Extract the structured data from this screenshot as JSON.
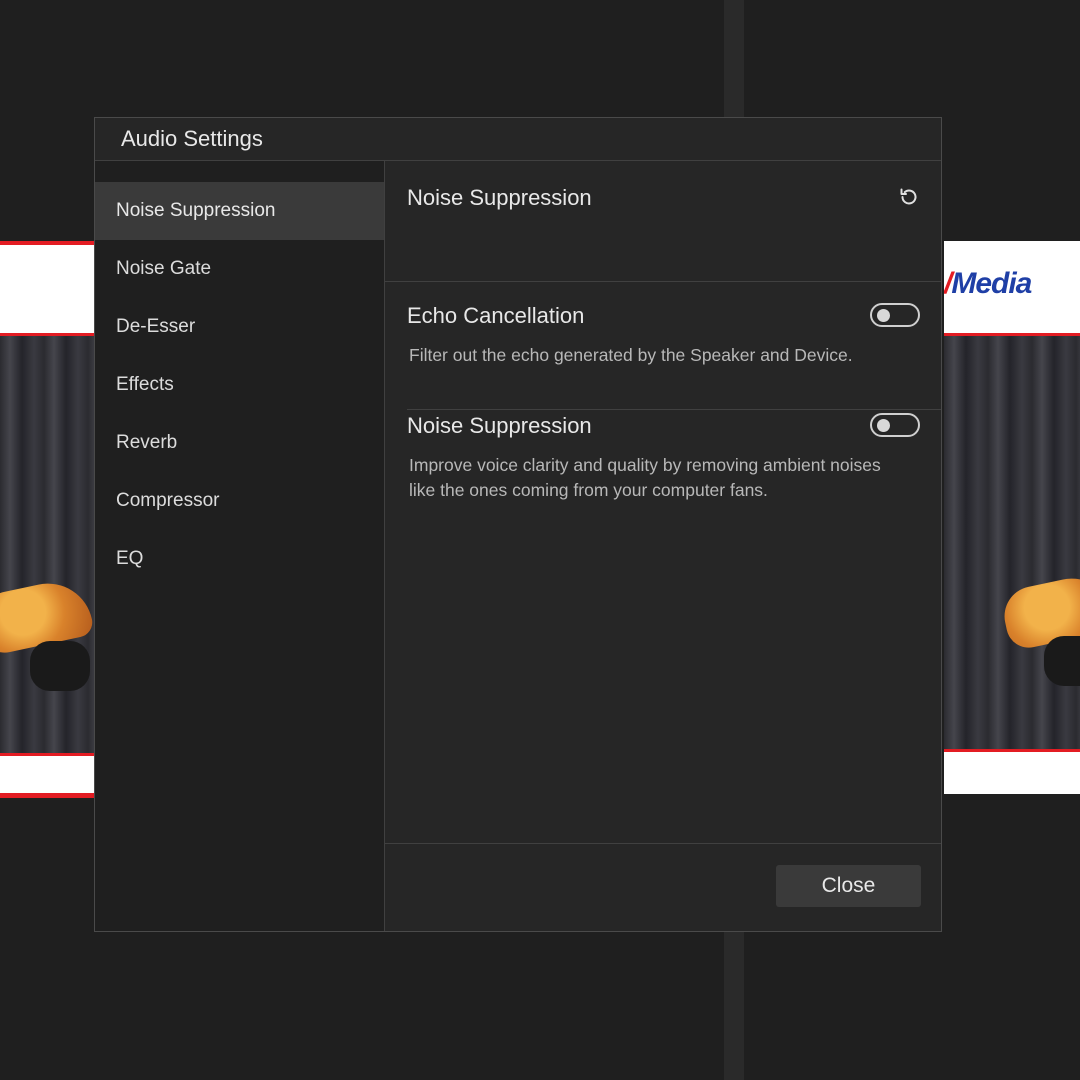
{
  "dialog": {
    "title": "Audio Settings",
    "close_label": "Close"
  },
  "sidebar": {
    "items": [
      {
        "label": "Noise Suppression",
        "active": true
      },
      {
        "label": "Noise Gate",
        "active": false
      },
      {
        "label": "De-Esser",
        "active": false
      },
      {
        "label": "Effects",
        "active": false
      },
      {
        "label": "Reverb",
        "active": false
      },
      {
        "label": "Compressor",
        "active": false
      },
      {
        "label": "EQ",
        "active": false
      }
    ]
  },
  "content": {
    "title": "Noise Suppression",
    "reset_icon": "reset-icon",
    "settings": [
      {
        "title": "Echo Cancellation",
        "description": "Filter out the echo generated by the Speaker and Device.",
        "enabled": false
      },
      {
        "title": "Noise Suppression",
        "description": "Improve voice clarity and quality by removing ambient noises like the ones coming from your computer fans.",
        "enabled": false
      }
    ]
  },
  "background": {
    "brand_text": "Media"
  },
  "colors": {
    "dialog_bg": "#262626",
    "sidebar_bg": "#1f1f1f",
    "active_item_bg": "#3a3a3a",
    "brand_red": "#e31c23",
    "brand_blue": "#1f3fa6"
  }
}
